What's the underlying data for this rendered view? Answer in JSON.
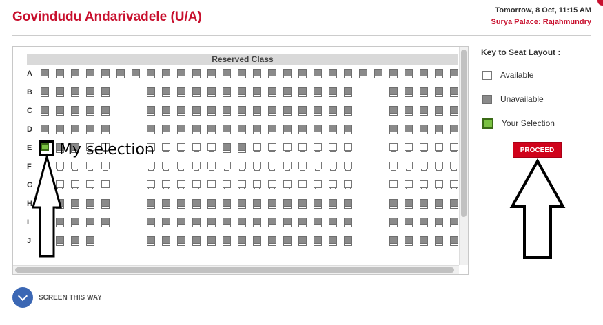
{
  "movie": {
    "title": "Govindudu Andarivadele (U/A)"
  },
  "show": {
    "datetime": "Tomorrow, 8 Oct, 11:15 AM",
    "venue": "Surya Palace: Rajahmundry"
  },
  "seat_layout": {
    "class_name": "Reserved Class",
    "rows": [
      {
        "label": "A",
        "seats": [
          [
            "un",
            40
          ],
          [
            "un",
            62
          ],
          [
            "un",
            84
          ],
          [
            "un",
            106
          ],
          [
            "un",
            128
          ],
          [
            "un",
            150
          ],
          [
            "un",
            172
          ],
          [
            "un",
            194
          ],
          [
            "un",
            216
          ],
          [
            "un",
            238
          ],
          [
            "un",
            260
          ],
          [
            "un",
            282
          ],
          [
            "un",
            304
          ],
          [
            "un",
            326
          ],
          [
            "un",
            348
          ],
          [
            "un",
            370
          ],
          [
            "un",
            392
          ],
          [
            "un",
            414
          ],
          [
            "un",
            436
          ],
          [
            "un",
            458
          ],
          [
            "un",
            480
          ],
          [
            "un",
            502
          ],
          [
            "un",
            524
          ],
          [
            "un",
            546
          ],
          [
            "un",
            568
          ],
          [
            "un",
            590
          ],
          [
            "un",
            612
          ],
          [
            "un",
            634
          ]
        ]
      },
      {
        "label": "B",
        "seats": [
          [
            "un",
            40
          ],
          [
            "un",
            62
          ],
          [
            "un",
            84
          ],
          [
            "un",
            106
          ],
          [
            "un",
            128
          ],
          [
            "un",
            194
          ],
          [
            "un",
            216
          ],
          [
            "un",
            238
          ],
          [
            "un",
            260
          ],
          [
            "un",
            282
          ],
          [
            "un",
            304
          ],
          [
            "un",
            326
          ],
          [
            "un",
            348
          ],
          [
            "un",
            370
          ],
          [
            "un",
            392
          ],
          [
            "un",
            414
          ],
          [
            "un",
            436
          ],
          [
            "un",
            458
          ],
          [
            "un",
            480
          ],
          [
            "un",
            546
          ],
          [
            "un",
            568
          ],
          [
            "un",
            590
          ],
          [
            "un",
            612
          ],
          [
            "un",
            634
          ]
        ]
      },
      {
        "label": "C",
        "seats": [
          [
            "un",
            40
          ],
          [
            "un",
            62
          ],
          [
            "un",
            84
          ],
          [
            "un",
            106
          ],
          [
            "un",
            128
          ],
          [
            "un",
            194
          ],
          [
            "un",
            216
          ],
          [
            "un",
            238
          ],
          [
            "un",
            260
          ],
          [
            "un",
            282
          ],
          [
            "un",
            304
          ],
          [
            "un",
            326
          ],
          [
            "un",
            348
          ],
          [
            "un",
            370
          ],
          [
            "un",
            392
          ],
          [
            "un",
            414
          ],
          [
            "un",
            436
          ],
          [
            "un",
            458
          ],
          [
            "un",
            480
          ],
          [
            "un",
            546
          ],
          [
            "un",
            568
          ],
          [
            "un",
            590
          ],
          [
            "un",
            612
          ],
          [
            "un",
            634
          ]
        ]
      },
      {
        "label": "D",
        "seats": [
          [
            "un",
            40
          ],
          [
            "un",
            62
          ],
          [
            "un",
            84
          ],
          [
            "un",
            106
          ],
          [
            "un",
            128
          ],
          [
            "un",
            194
          ],
          [
            "un",
            216
          ],
          [
            "un",
            238
          ],
          [
            "un",
            260
          ],
          [
            "un",
            282
          ],
          [
            "un",
            304
          ],
          [
            "un",
            326
          ],
          [
            "un",
            348
          ],
          [
            "un",
            370
          ],
          [
            "un",
            392
          ],
          [
            "un",
            414
          ],
          [
            "un",
            436
          ],
          [
            "un",
            458
          ],
          [
            "un",
            480
          ],
          [
            "un",
            546
          ],
          [
            "un",
            568
          ],
          [
            "un",
            590
          ],
          [
            "un",
            612
          ],
          [
            "un",
            634
          ]
        ]
      },
      {
        "label": "E",
        "seats": [
          [
            "sel",
            40
          ],
          [
            "un",
            62
          ],
          [
            "un",
            84
          ],
          [
            "av",
            106
          ],
          [
            "av",
            128
          ],
          [
            "av",
            194
          ],
          [
            "av",
            216
          ],
          [
            "av",
            238
          ],
          [
            "av",
            260
          ],
          [
            "av",
            282
          ],
          [
            "un",
            304
          ],
          [
            "un",
            326
          ],
          [
            "av",
            348
          ],
          [
            "av",
            370
          ],
          [
            "av",
            392
          ],
          [
            "av",
            414
          ],
          [
            "av",
            436
          ],
          [
            "av",
            458
          ],
          [
            "av",
            480
          ],
          [
            "av",
            546
          ],
          [
            "av",
            568
          ],
          [
            "av",
            590
          ],
          [
            "av",
            612
          ],
          [
            "av",
            634
          ]
        ]
      },
      {
        "label": "F",
        "seats": [
          [
            "av",
            40
          ],
          [
            "av",
            62
          ],
          [
            "av",
            84
          ],
          [
            "av",
            106
          ],
          [
            "av",
            128
          ],
          [
            "av",
            194
          ],
          [
            "av",
            216
          ],
          [
            "av",
            238
          ],
          [
            "av",
            260
          ],
          [
            "av",
            282
          ],
          [
            "av",
            304
          ],
          [
            "av",
            326
          ],
          [
            "av",
            348
          ],
          [
            "av",
            370
          ],
          [
            "av",
            392
          ],
          [
            "av",
            414
          ],
          [
            "av",
            436
          ],
          [
            "av",
            458
          ],
          [
            "av",
            480
          ],
          [
            "av",
            546
          ],
          [
            "av",
            568
          ],
          [
            "av",
            590
          ],
          [
            "av",
            612
          ],
          [
            "av",
            634
          ]
        ]
      },
      {
        "label": "G",
        "seats": [
          [
            "av",
            40
          ],
          [
            "av",
            62
          ],
          [
            "av",
            84
          ],
          [
            "av",
            106
          ],
          [
            "av",
            128
          ],
          [
            "av",
            194
          ],
          [
            "av",
            216
          ],
          [
            "av",
            238
          ],
          [
            "av",
            260
          ],
          [
            "av",
            282
          ],
          [
            "av",
            304
          ],
          [
            "av",
            326
          ],
          [
            "av",
            348
          ],
          [
            "av",
            370
          ],
          [
            "av",
            392
          ],
          [
            "av",
            414
          ],
          [
            "av",
            436
          ],
          [
            "av",
            458
          ],
          [
            "av",
            480
          ],
          [
            "av",
            546
          ],
          [
            "av",
            568
          ],
          [
            "av",
            590
          ],
          [
            "av",
            612
          ],
          [
            "av",
            634
          ]
        ]
      },
      {
        "label": "H",
        "seats": [
          [
            "un",
            40
          ],
          [
            "un",
            62
          ],
          [
            "un",
            84
          ],
          [
            "un",
            106
          ],
          [
            "un",
            128
          ],
          [
            "un",
            194
          ],
          [
            "un",
            216
          ],
          [
            "un",
            238
          ],
          [
            "un",
            260
          ],
          [
            "un",
            282
          ],
          [
            "un",
            304
          ],
          [
            "un",
            326
          ],
          [
            "un",
            348
          ],
          [
            "un",
            370
          ],
          [
            "un",
            392
          ],
          [
            "un",
            414
          ],
          [
            "un",
            436
          ],
          [
            "un",
            458
          ],
          [
            "un",
            480
          ],
          [
            "un",
            546
          ],
          [
            "un",
            568
          ],
          [
            "un",
            590
          ],
          [
            "un",
            612
          ],
          [
            "un",
            634
          ]
        ]
      },
      {
        "label": "I",
        "seats": [
          [
            "un",
            40
          ],
          [
            "un",
            62
          ],
          [
            "un",
            84
          ],
          [
            "un",
            106
          ],
          [
            "un",
            128
          ],
          [
            "un",
            194
          ],
          [
            "un",
            216
          ],
          [
            "un",
            238
          ],
          [
            "un",
            260
          ],
          [
            "un",
            282
          ],
          [
            "un",
            304
          ],
          [
            "un",
            326
          ],
          [
            "un",
            348
          ],
          [
            "un",
            370
          ],
          [
            "un",
            392
          ],
          [
            "un",
            414
          ],
          [
            "un",
            436
          ],
          [
            "un",
            458
          ],
          [
            "un",
            480
          ],
          [
            "un",
            546
          ],
          [
            "un",
            568
          ],
          [
            "un",
            590
          ],
          [
            "un",
            612
          ],
          [
            "un",
            634
          ]
        ]
      },
      {
        "label": "J",
        "seats": [
          [
            "un",
            40
          ],
          [
            "un",
            62
          ],
          [
            "un",
            84
          ],
          [
            "un",
            106
          ],
          [
            "un",
            194
          ],
          [
            "un",
            216
          ],
          [
            "un",
            238
          ],
          [
            "un",
            260
          ],
          [
            "un",
            282
          ],
          [
            "un",
            304
          ],
          [
            "un",
            326
          ],
          [
            "un",
            348
          ],
          [
            "un",
            370
          ],
          [
            "un",
            392
          ],
          [
            "un",
            414
          ],
          [
            "un",
            436
          ],
          [
            "un",
            458
          ],
          [
            "un",
            480
          ],
          [
            "un",
            546
          ],
          [
            "un",
            568
          ],
          [
            "un",
            590
          ],
          [
            "un",
            612
          ],
          [
            "un",
            634
          ]
        ]
      }
    ]
  },
  "key": {
    "title": "Key to Seat Layout :",
    "items": [
      {
        "label": "Available",
        "type": "available"
      },
      {
        "label": "Unavailable",
        "type": "unavailable"
      },
      {
        "label": "Your Selection",
        "type": "selection"
      }
    ]
  },
  "actions": {
    "proceed_label": "PROCEED",
    "screen_label": "SCREEN THIS WAY"
  },
  "annotations": {
    "selection_text": "My selection"
  },
  "colors": {
    "brand_red": "#c8102e",
    "selected_green": "#7ac142",
    "unavailable_gray": "#8a8a8a",
    "screen_blue": "#3b67b4"
  },
  "icons": {
    "screen": "chevron-down-icon"
  }
}
